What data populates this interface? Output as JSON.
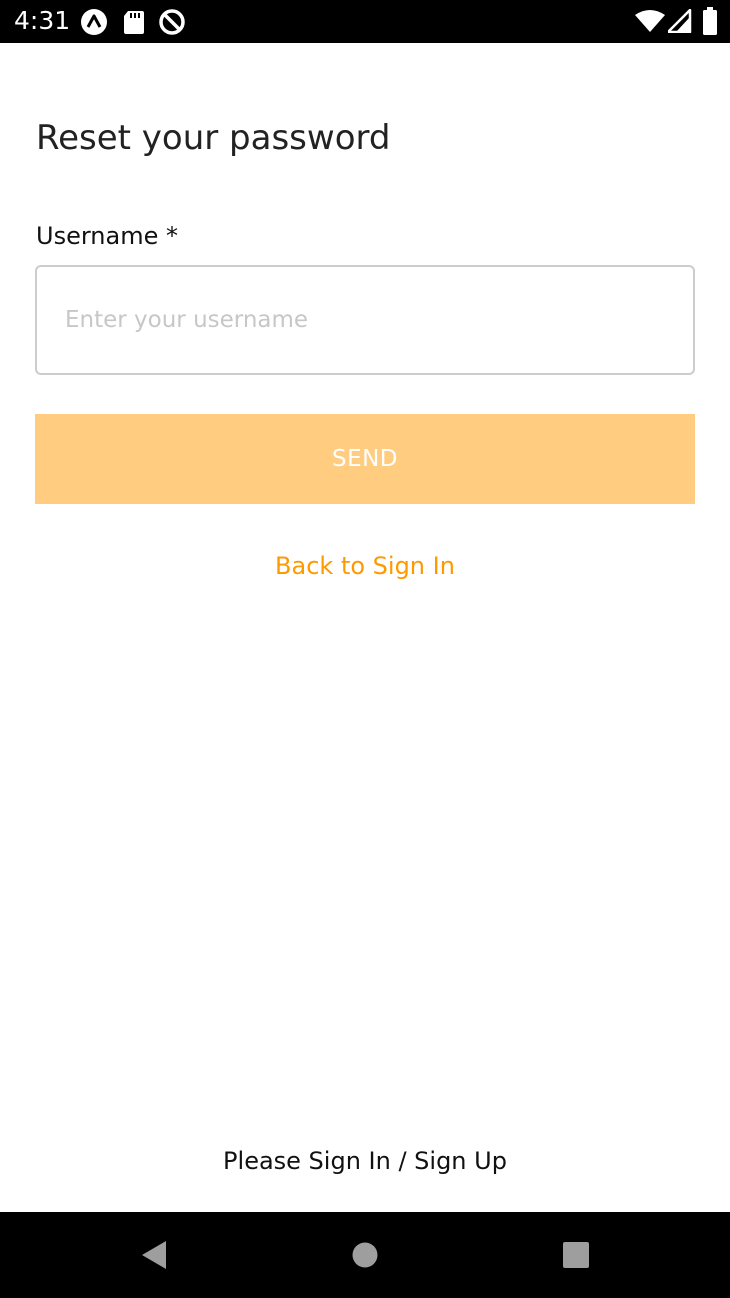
{
  "status_bar": {
    "time": "4:31",
    "left_icons": [
      "app-a-icon",
      "sd-card-icon",
      "do-not-disturb-icon"
    ],
    "right_icons": [
      "wifi-icon",
      "cell-signal-icon",
      "battery-icon"
    ]
  },
  "form": {
    "title": "Reset your password",
    "username_label": "Username *",
    "username_placeholder": "Enter your username",
    "username_value": "",
    "send_label": "SEND",
    "back_link": "Back to Sign In"
  },
  "footer": {
    "text": "Please Sign In / Sign Up"
  },
  "nav_bar": {
    "buttons": [
      "back-icon",
      "home-icon",
      "recents-icon"
    ]
  },
  "colors": {
    "accent": "#ff9900",
    "button_disabled": "#ffcc80",
    "status_bar": "#000000"
  }
}
